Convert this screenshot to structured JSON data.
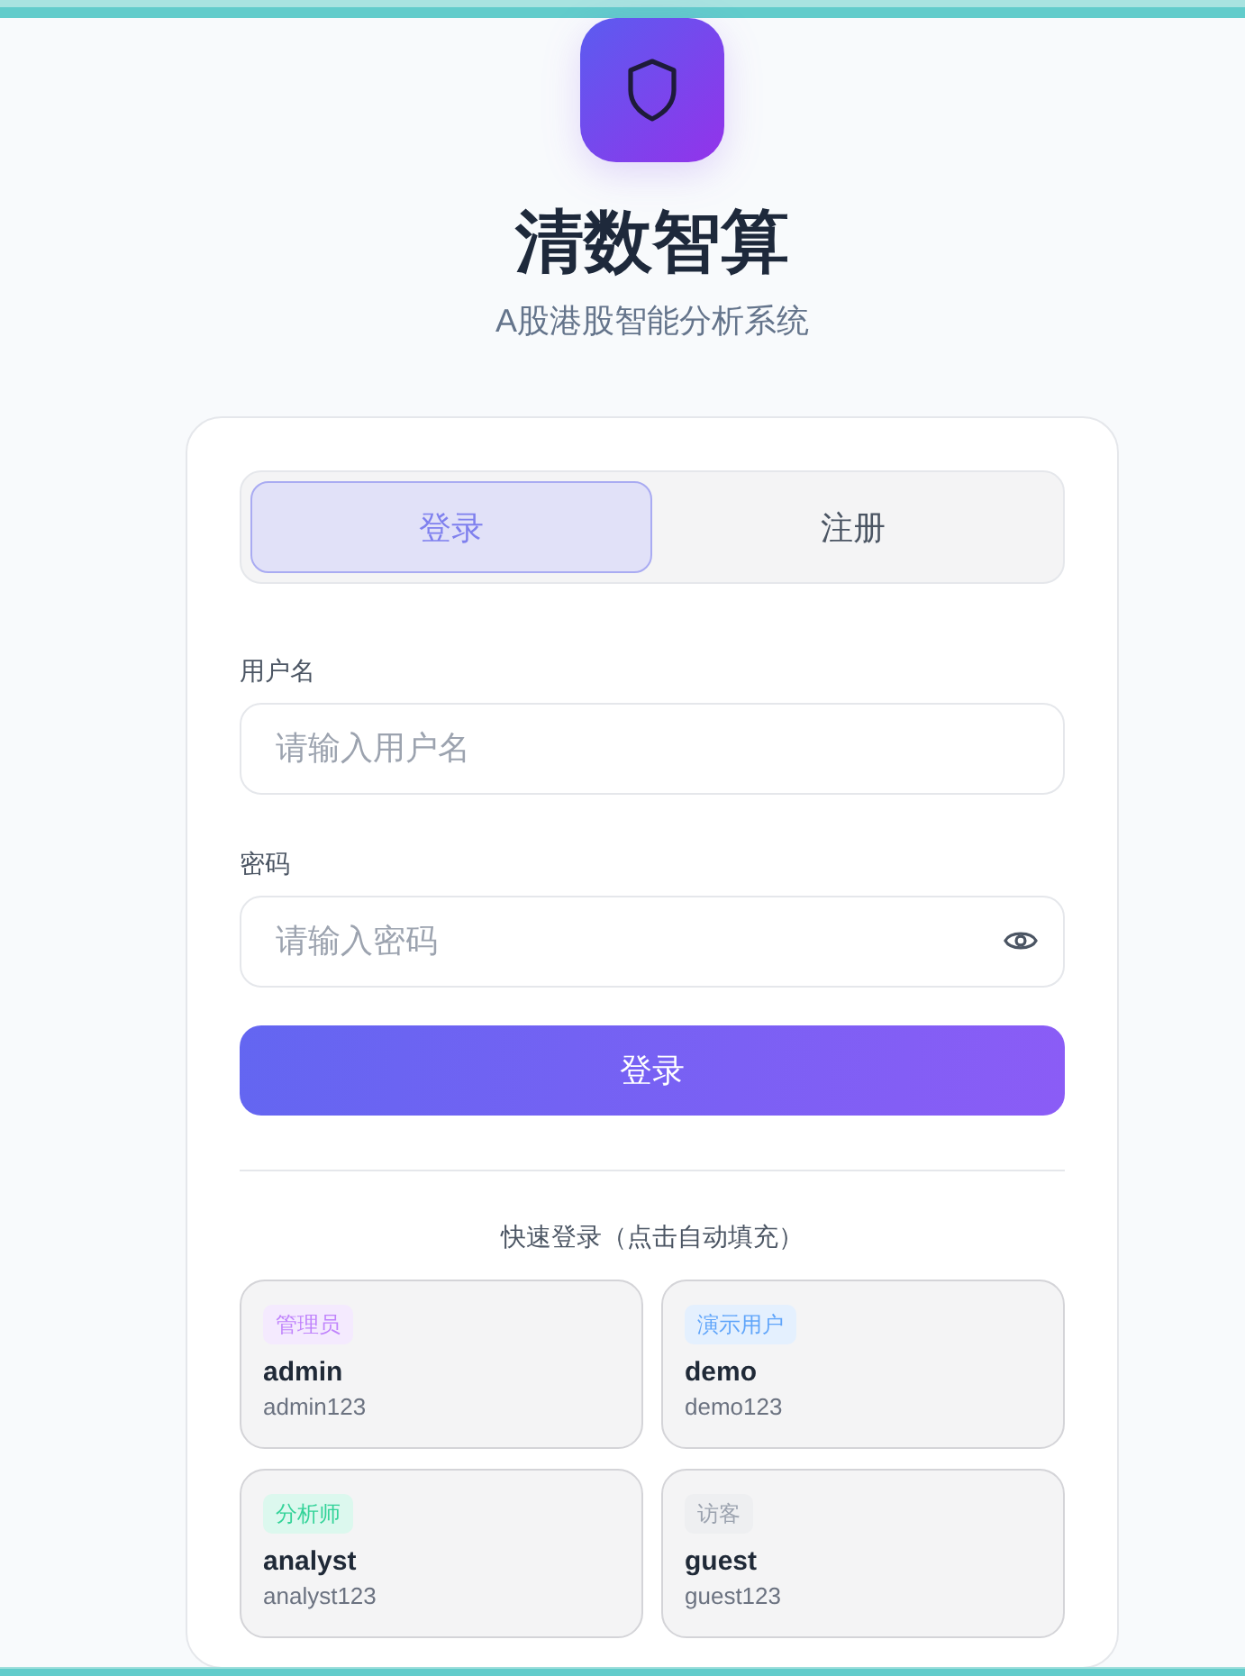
{
  "brand": {
    "title": "清数智算",
    "subtitle": "A股港股智能分析系统"
  },
  "tabs": [
    {
      "label": "登录",
      "selected": true
    },
    {
      "label": "注册",
      "selected": false
    }
  ],
  "form": {
    "fields": [
      {
        "kind": "text",
        "label": "用户名",
        "placeholder": "请输入用户名"
      },
      {
        "kind": "password",
        "label": "密码",
        "placeholder": "请输入密码"
      }
    ],
    "submit": "登录"
  },
  "quick_login": {
    "title": "快速登录（点击自动填充）",
    "accounts": [
      {
        "role": "管理员",
        "color": "#c084fc",
        "username": "admin",
        "password": "admin123"
      },
      {
        "role": "演示用户",
        "color": "#60a5fa",
        "username": "demo",
        "password": "demo123"
      },
      {
        "role": "分析师",
        "color": "#34d399",
        "username": "analyst",
        "password": "analyst123"
      },
      {
        "role": "访客",
        "color": "#9ca3af",
        "username": "guest",
        "password": "guest123"
      }
    ]
  }
}
